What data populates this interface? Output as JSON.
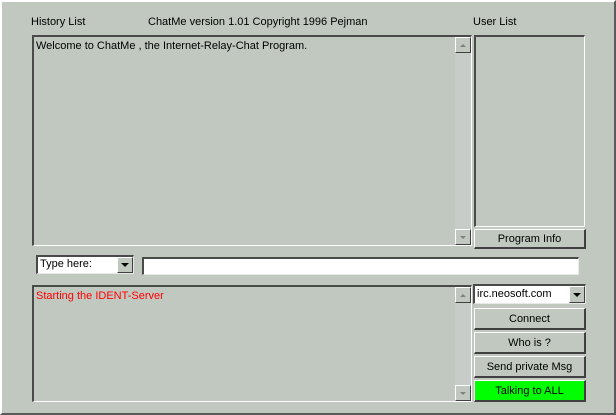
{
  "labels": {
    "history_list": "History List",
    "title": "ChatMe version 1.01 Copyright 1996 Pejman",
    "user_list": "User List"
  },
  "history": {
    "lines": [
      "Welcome to ChatMe , the Internet-Relay-Chat Program."
    ]
  },
  "users": [],
  "buttons": {
    "program_info": "Program Info",
    "connect": "Connect",
    "who_is": "Who is ?",
    "send_private": "Send private Msg",
    "talking_all": "Talking to ALL"
  },
  "input_row": {
    "mode_selected": "Type here:",
    "message_value": "",
    "message_placeholder": ""
  },
  "status": {
    "lines": [
      "Starting the IDENT-Server"
    ]
  },
  "server": {
    "selected": "irc.neosoft.com"
  },
  "colors": {
    "background": "#c0c8c0",
    "status_text": "#ff0000",
    "talking_button": "#00ff00"
  }
}
